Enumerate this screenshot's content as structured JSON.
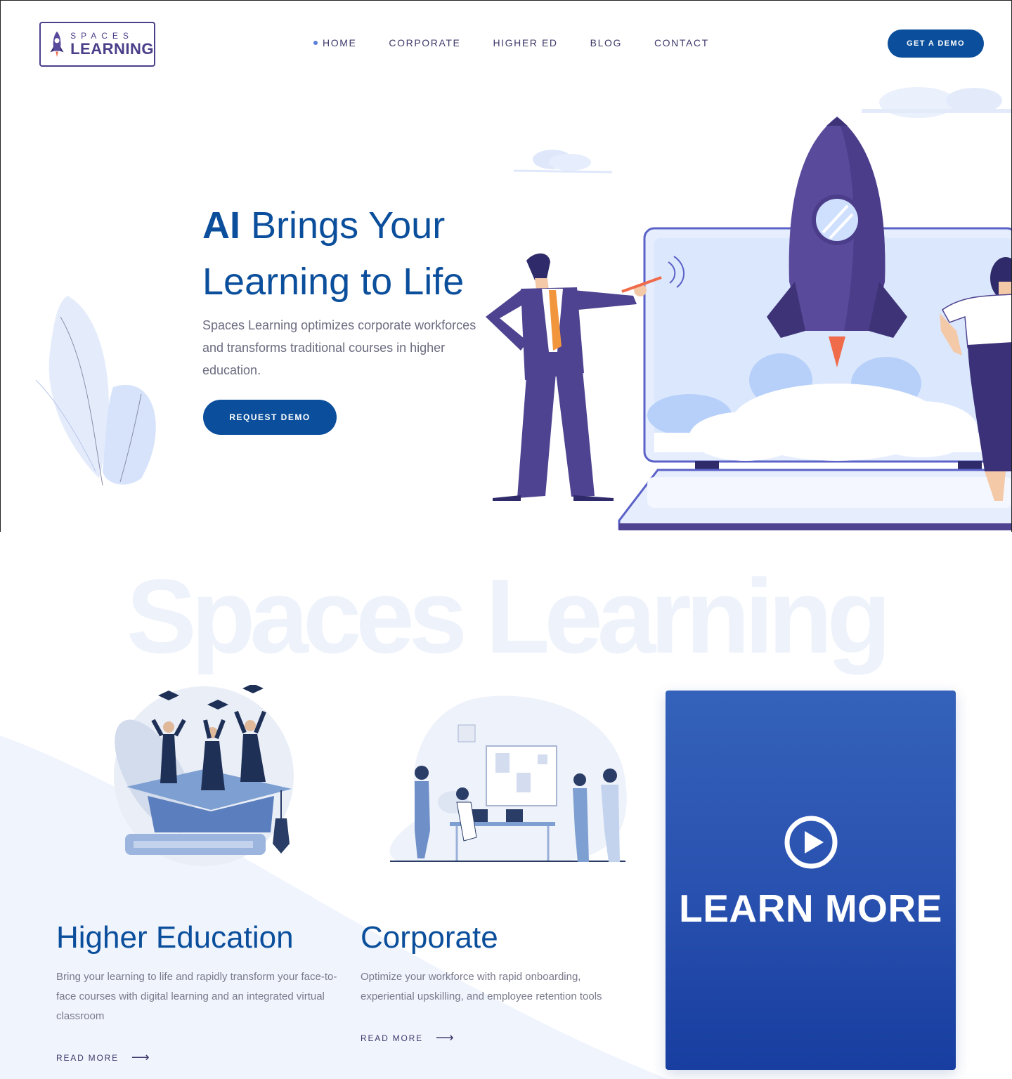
{
  "header": {
    "logo_small": "SPACES",
    "logo_big": "LEARNING",
    "nav": [
      "HOME",
      "CORPORATE",
      "HIGHER ED",
      "BLOG",
      "CONTACT"
    ],
    "cta": "GET A DEMO"
  },
  "hero": {
    "title_bold": "AI",
    "title_rest": " Brings Your",
    "title_line2": "Learning to Life",
    "description": "Spaces Learning optimizes corporate workforces and transforms traditional courses in higher education.",
    "button": "REQUEST DEMO"
  },
  "watermark": "Spaces Learning",
  "cards": {
    "higher_ed": {
      "title": "Higher Education",
      "description": "Bring your learning to life and rapidly transform your face-to-face courses with digital learning and an integrated virtual classroom",
      "link": "READ MORE"
    },
    "corporate": {
      "title": "Corporate",
      "description": "Optimize your workforce with rapid onboarding, experiential upskilling, and employee retention tools",
      "link": "READ MORE"
    },
    "video": {
      "label": "LEARN MORE"
    }
  },
  "colors": {
    "primary": "#0b4f9c",
    "brand_purple": "#4b3f8a",
    "card_blue": "#2a52b0"
  }
}
